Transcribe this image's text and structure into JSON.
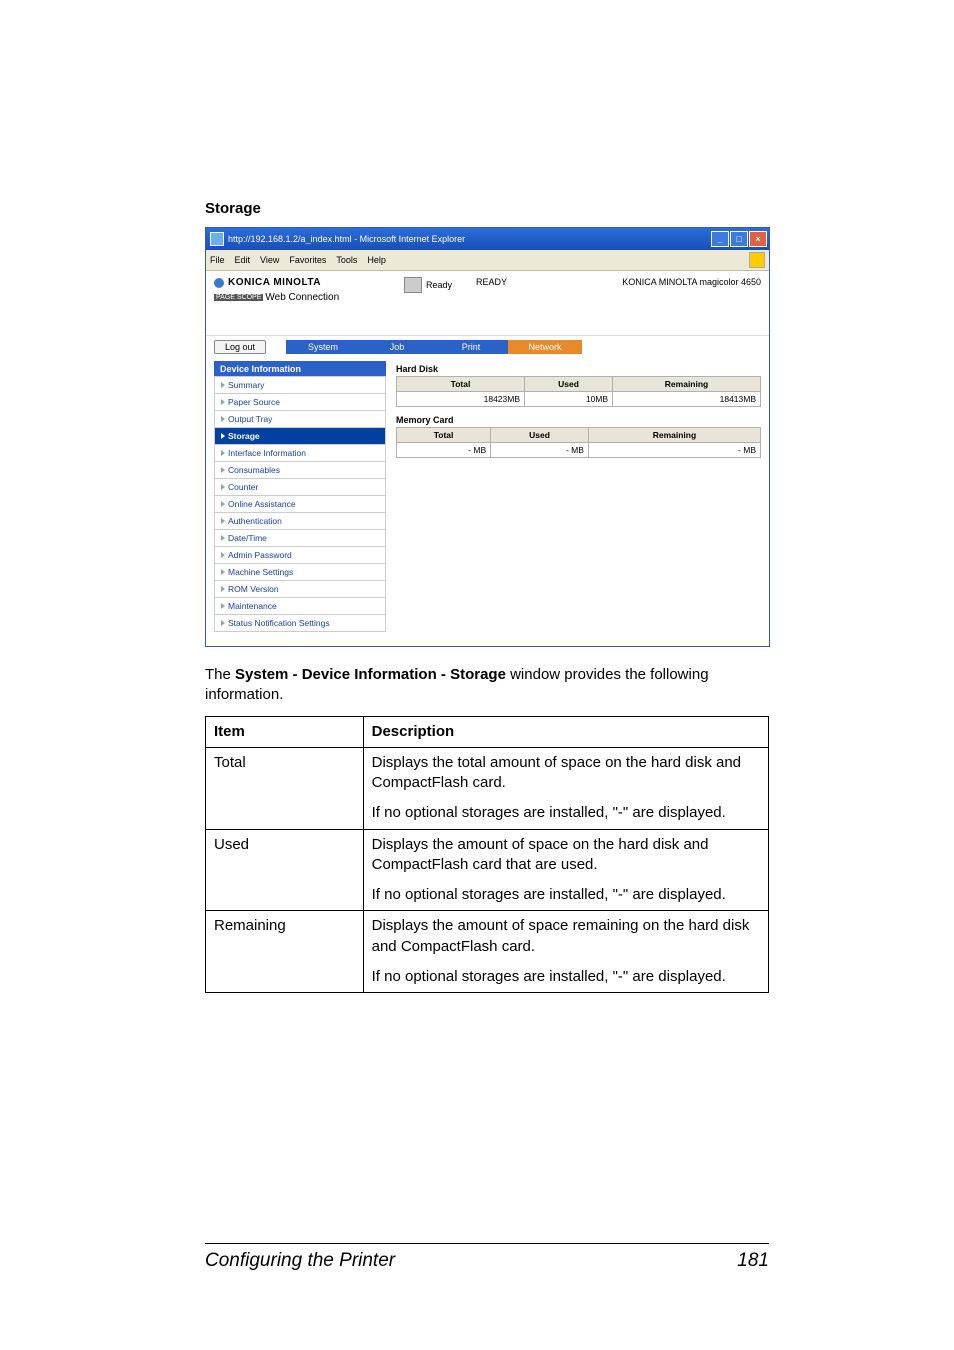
{
  "doc": {
    "section_title": "Storage",
    "intro_prefix": "The ",
    "intro_bold": "System - Device Information - Storage",
    "intro_suffix": " window provides the following information.",
    "footer_left": "Configuring the Printer",
    "footer_right": "181"
  },
  "screenshot": {
    "title": "http://192.168.1.2/a_index.html - Microsoft Internet Explorer",
    "menus": [
      "File",
      "Edit",
      "View",
      "Favorites",
      "Tools",
      "Help"
    ],
    "brand_line1": "KONICA MINOLTA",
    "brand_ps": "PAGE SCOPE",
    "brand_line2": " Web Connection",
    "status_ready": "Ready",
    "status_msg": "READY",
    "model": "KONICA MINOLTA magicolor 4650",
    "logout": "Log out",
    "tabs": [
      "System",
      "Job",
      "Print",
      "Network"
    ],
    "sidebar_header": "Device Information",
    "sidebar": [
      "Summary",
      "Paper Source",
      "Output Tray",
      "Storage",
      "Interface Information",
      "Consumables",
      "Counter",
      "Online Assistance",
      "Authentication",
      "Date/Time",
      "Admin Password",
      "Machine Settings",
      "ROM Version",
      "Maintenance",
      "Status Notification Settings"
    ],
    "hd_title": "Hard Disk",
    "mc_title": "Memory Card",
    "cols": [
      "Total",
      "Used",
      "Remaining"
    ],
    "hd_row": [
      "18423MB",
      "10MB",
      "18413MB"
    ],
    "mc_row": [
      "- MB",
      "- MB",
      "- MB"
    ]
  },
  "table": {
    "head_item": "Item",
    "head_desc": "Description",
    "rows": [
      {
        "item": "Total",
        "p1": "Displays the total amount of space on the hard disk and CompactFlash card.",
        "p2": "If no optional storages are installed, \"-\" are displayed."
      },
      {
        "item": "Used",
        "p1": "Displays the amount of space on the hard disk and CompactFlash card that are used.",
        "p2": "If no optional storages are installed, \"-\" are displayed."
      },
      {
        "item": "Remaining",
        "p1": "Displays the amount of space remaining on the hard disk and CompactFlash card.",
        "p2": "If no optional storages are installed, \"-\" are displayed."
      }
    ]
  }
}
